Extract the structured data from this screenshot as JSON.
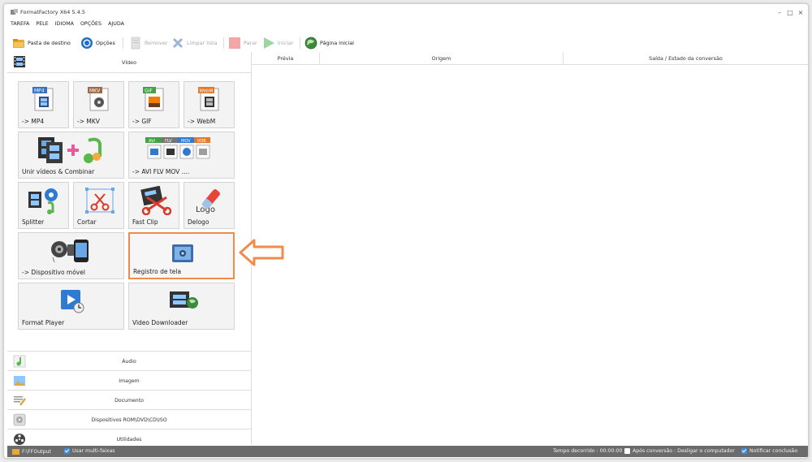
{
  "window": {
    "title": "FormatFactory X64 5.4.5",
    "minimize": "–",
    "maximize": "□",
    "close": "×"
  },
  "menu": [
    "TAREFA",
    "PELE",
    "IDIOMA",
    "OPÇÕES",
    "AJUDA"
  ],
  "toolbar": {
    "destination": "Pasta de destino",
    "options": "Opções",
    "remove": "Remover",
    "clear": "Limpar lista",
    "stop": "Parar",
    "start": "Iniciar",
    "home": "Página inicial"
  },
  "video_header": "Vídeo",
  "tiles": {
    "mp4": {
      "label": "-> MP4",
      "badge": "MP4"
    },
    "mkv": {
      "label": "-> MKV",
      "badge": "MKV"
    },
    "gif": {
      "label": "-> GIF",
      "badge": "GIF"
    },
    "webm": {
      "label": "-> WebM",
      "badge": "WebM"
    },
    "merge": {
      "label": "Unir vídeos & Combinar"
    },
    "avi": {
      "label": "-> AVI FLV MOV ....",
      "badges": [
        "AVI",
        "FLV",
        "MOV",
        "VOB"
      ]
    },
    "splitter": {
      "label": "Splitter"
    },
    "cut": {
      "label": "Cortar"
    },
    "fastclip": {
      "label": "Fast Clip"
    },
    "delogo": {
      "label": "Delogo",
      "icon_text": "Logo"
    },
    "mobile": {
      "label": "-> Dispositivo móvel"
    },
    "screen": {
      "label": "Registro de tela"
    },
    "player": {
      "label": "Format Player"
    },
    "downloader": {
      "label": "Video Downloader"
    }
  },
  "categories": {
    "audio": "Áudio",
    "image": "Imagem",
    "document": "Documento",
    "rom": "Dispositivos ROM\\DVD\\CD\\ISO",
    "utilities": "Utilidades"
  },
  "table": {
    "headers": [
      "Prévia",
      "Origem",
      "Saída / Estado da conversão"
    ]
  },
  "status": {
    "path": "F:\\FFOutput",
    "multi": "Usar multi-faixas",
    "elapsed": "Tempo decorrido : 00:00:00",
    "after": "Após conversão : Desligar o computador",
    "notify": "Notificar conclusão"
  },
  "colors": {
    "accent_orange": "#f08b4b",
    "status_bg": "#6b6b6b",
    "checkbox_blue": "#3d8fe0"
  }
}
